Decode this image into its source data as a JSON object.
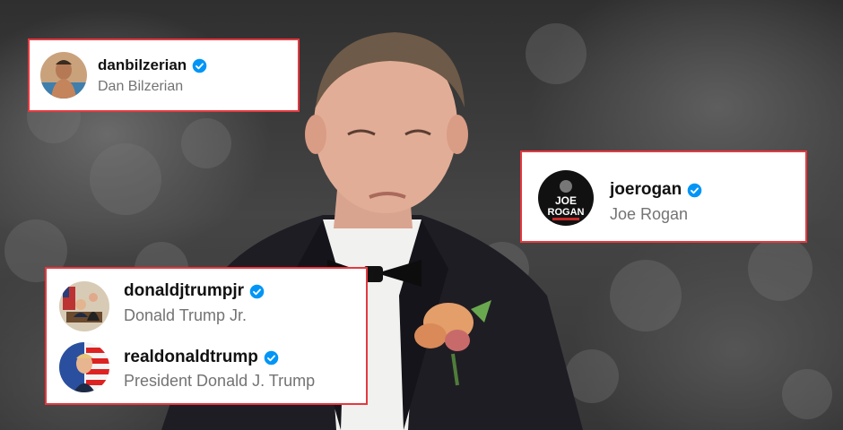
{
  "colors": {
    "card_border": "#e5393f",
    "verified_blue": "#0095f6",
    "username_text": "#111111",
    "display_name_text": "#737373"
  },
  "profiles": [
    {
      "username": "danbilzerian",
      "display_name": "Dan Bilzerian",
      "verified": true,
      "avatar": "shirtless-man-avatar"
    },
    {
      "username": "joerogan",
      "display_name": "Joe Rogan",
      "verified": true,
      "avatar": "joe-rogan-logo-avatar",
      "avatar_text_line1": "JOE",
      "avatar_text_line2": "ROGAN"
    },
    {
      "username": "donaldjtrumpjr",
      "display_name": "Donald Trump Jr.",
      "verified": true,
      "avatar": "oval-office-avatar"
    },
    {
      "username": "realdonaldtrump",
      "display_name": "President Donald J. Trump",
      "verified": true,
      "avatar": "flag-portrait-avatar"
    }
  ]
}
